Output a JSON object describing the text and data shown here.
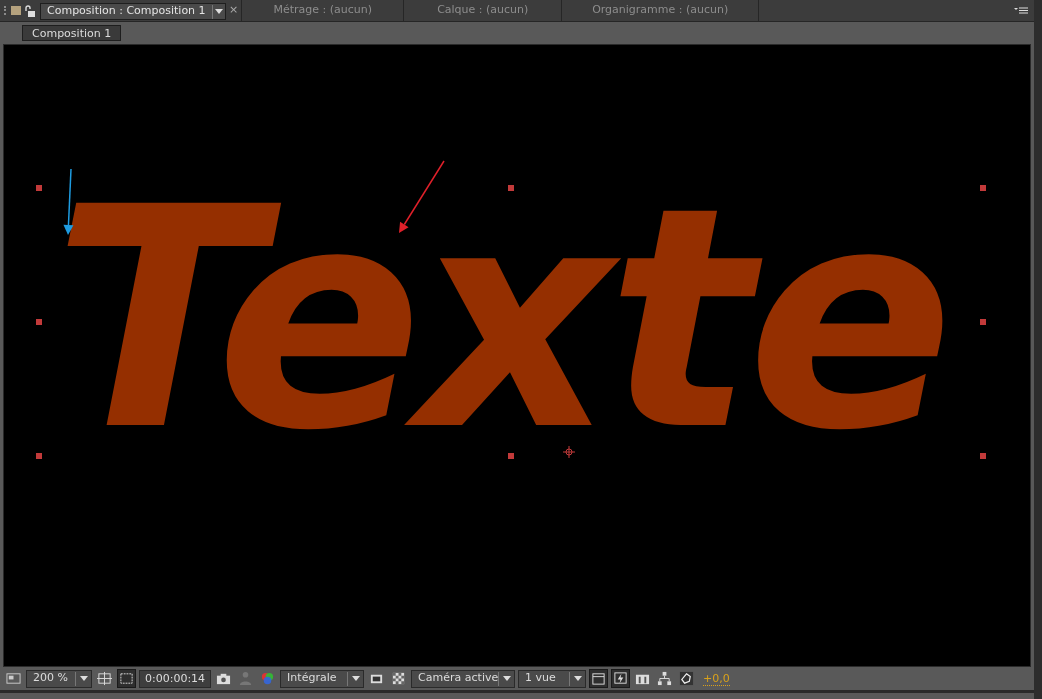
{
  "tabs": [
    {
      "label": "Composition : Composition 1",
      "selected": true
    },
    {
      "label": "Métrage : (aucun)",
      "selected": false
    },
    {
      "label": "Calque : (aucun)",
      "selected": false
    },
    {
      "label": "Organigramme : (aucun)",
      "selected": false
    }
  ],
  "close_glyph": "×",
  "breadcrumb": "Composition 1",
  "viewer": {
    "text": "Texte",
    "color": "#952f00"
  },
  "annotations": [
    {
      "kind": "arrow",
      "color": "#1e9be0"
    },
    {
      "kind": "arrow",
      "color": "#e0202a"
    }
  ],
  "toolbar": [
    {
      "kind": "icon",
      "pressed": false
    },
    {
      "kind": "dropdown",
      "value": "200 %"
    },
    {
      "kind": "icon",
      "pressed": false
    },
    {
      "kind": "icon",
      "pressed": true
    },
    {
      "kind": "timecode",
      "value": "0:00:00:14"
    },
    {
      "kind": "icon",
      "pressed": false
    },
    {
      "kind": "icon",
      "pressed": false
    },
    {
      "kind": "icon",
      "pressed": false
    },
    {
      "kind": "dropdown",
      "value": "Intégrale"
    },
    {
      "kind": "icon",
      "pressed": false
    },
    {
      "kind": "icon",
      "pressed": false
    },
    {
      "kind": "dropdown",
      "value": "Caméra active"
    },
    {
      "kind": "dropdown",
      "value": "1 vue"
    },
    {
      "kind": "icon",
      "pressed": true
    },
    {
      "kind": "icon",
      "pressed": true
    },
    {
      "kind": "icon",
      "pressed": false
    },
    {
      "kind": "icon",
      "pressed": false
    },
    {
      "kind": "icon",
      "pressed": false
    },
    {
      "kind": "value",
      "value": "+0,0"
    }
  ]
}
